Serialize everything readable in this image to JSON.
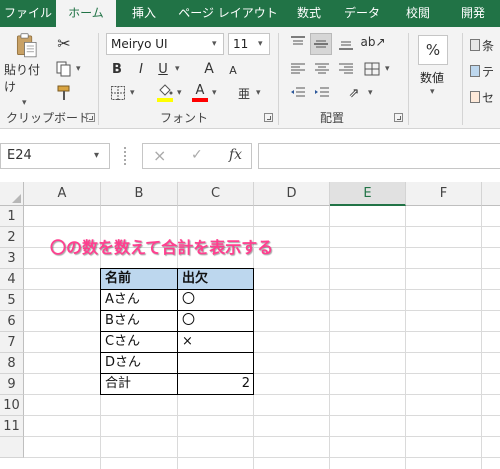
{
  "ribbon": {
    "tabs": [
      "ファイル",
      "ホーム",
      "挿入",
      "ページ レイアウト",
      "数式",
      "データ",
      "校閲",
      "開発"
    ],
    "active_tab": "ホーム",
    "groups": {
      "clipboard": "クリップボード",
      "font": "フォント",
      "alignment": "配置",
      "number": "数値"
    },
    "paste_label": "貼り付け",
    "font_name": "Meiryo UI",
    "font_size": "11",
    "number_btn": "%",
    "number_label": "数値",
    "bold": "B",
    "italic": "I",
    "underline": "U",
    "grow_font": "A",
    "shrink_font": "A",
    "font_color_glyph": "A",
    "furigana": "亜",
    "right_edge": [
      "条",
      "テ",
      "セ"
    ]
  },
  "formula_bar": {
    "name_box": "E24",
    "fx": "fx",
    "cancel": "×",
    "enter": "✓"
  },
  "sheet": {
    "columns": [
      "A",
      "B",
      "C",
      "D",
      "E",
      "F"
    ],
    "selected_column": "E",
    "rows": [
      "1",
      "2",
      "3",
      "4",
      "5",
      "6",
      "7",
      "8",
      "9",
      "10",
      "11"
    ],
    "note": "〇の数を数えて合計を表示する",
    "table": {
      "header": [
        "名前",
        "出欠"
      ],
      "rows": [
        [
          "Aさん",
          "〇"
        ],
        [
          "Bさん",
          "〇"
        ],
        [
          "Cさん",
          "×"
        ],
        [
          "Dさん",
          ""
        ],
        [
          "合計",
          "2"
        ]
      ]
    }
  },
  "colors": {
    "excel_green": "#217346",
    "table_header": "#bdd7ee",
    "note_pink": "#ff3f8f",
    "font_color_bar": "#ff0000",
    "fill_color_bar": "#ffff00"
  }
}
